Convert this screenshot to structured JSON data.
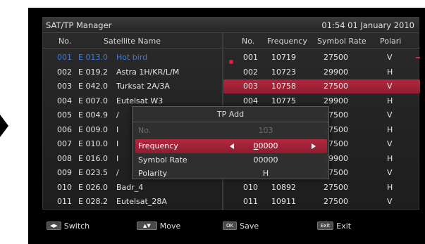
{
  "title": "SAT/TP Manager",
  "clock": "01:54 01 January 2010",
  "satellite_header": {
    "no": "No.",
    "name": "Satellite Name"
  },
  "tp_header": {
    "no": "No.",
    "frequency": "Frequency",
    "symbol_rate": "Symbol Rate",
    "polarity": "Polari"
  },
  "satellites": [
    {
      "no": "001",
      "pos": "E 013.0",
      "name": "Hot bird"
    },
    {
      "no": "002",
      "pos": "E 019.2",
      "name": "Astra 1H/KR/L/M"
    },
    {
      "no": "003",
      "pos": "E 042.0",
      "name": "Turksat 2A/3A"
    },
    {
      "no": "004",
      "pos": "E 007.0",
      "name": "Eutelsat W3"
    },
    {
      "no": "005",
      "pos": "E 004.9",
      "name": "/"
    },
    {
      "no": "006",
      "pos": "E 009.0",
      "name": "I"
    },
    {
      "no": "007",
      "pos": "E 010.0",
      "name": "I"
    },
    {
      "no": "008",
      "pos": "E 016.0",
      "name": "I"
    },
    {
      "no": "009",
      "pos": "E 023.5",
      "name": "/"
    },
    {
      "no": "010",
      "pos": "E 026.0",
      "name": "Badr_4"
    },
    {
      "no": "011",
      "pos": "E 028.2",
      "name": "Eutelsat_28A"
    }
  ],
  "transponders": [
    {
      "no": "001",
      "frequency": "10719",
      "symbol_rate": "27500",
      "polarity": "V"
    },
    {
      "no": "002",
      "frequency": "10723",
      "symbol_rate": "29900",
      "polarity": "H"
    },
    {
      "no": "003",
      "frequency": "10758",
      "symbol_rate": "27500",
      "polarity": "V"
    },
    {
      "no": "004",
      "frequency": "10775",
      "symbol_rate": "29900",
      "polarity": "H"
    },
    {
      "no": "",
      "frequency": "",
      "symbol_rate": "27500",
      "polarity": "V"
    },
    {
      "no": "",
      "frequency": "",
      "symbol_rate": "27500",
      "polarity": "H"
    },
    {
      "no": "",
      "frequency": "",
      "symbol_rate": "27500",
      "polarity": "V"
    },
    {
      "no": "",
      "frequency": "",
      "symbol_rate": "29900",
      "polarity": "H"
    },
    {
      "no": "",
      "frequency": "",
      "symbol_rate": "27500",
      "polarity": "V"
    },
    {
      "no": "010",
      "frequency": "10892",
      "symbol_rate": "27500",
      "polarity": "H"
    },
    {
      "no": "011",
      "frequency": "10911",
      "symbol_rate": "27500",
      "polarity": "V"
    }
  ],
  "dialog": {
    "title": "TP Add",
    "no_label": "No.",
    "no_value": "103",
    "frequency_label": "Frequency",
    "frequency_cursor": "0",
    "frequency_rest": "0000",
    "symbol_rate_label": "Symbol Rate",
    "symbol_rate_value": "00000",
    "polarity_label": "Polarity",
    "polarity_value": "H"
  },
  "footer": {
    "switch_key": "◀▶",
    "switch_label": "Switch",
    "move_key": "▲▼",
    "move_label": "Move",
    "save_key": "OK",
    "save_label": "Save",
    "exit_key": "Exit",
    "exit_label": "Exit"
  },
  "colors": {
    "selection": "#b4273e",
    "highlight_text": "#3d7bd9",
    "scroll_marker": "#e0233d"
  }
}
